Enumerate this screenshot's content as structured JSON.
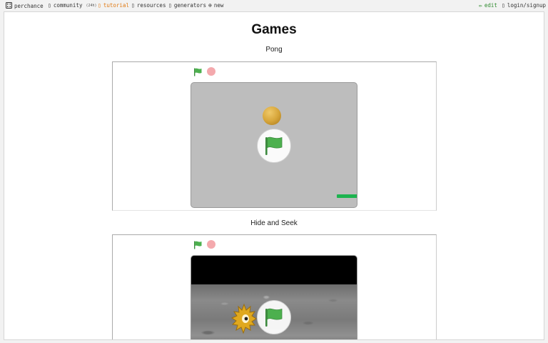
{
  "topbar": {
    "brand": "perchance",
    "community": "community",
    "community_badge": "(24h)",
    "tutorial": "tutorial",
    "resources": "resources",
    "generators": "generators",
    "new": "new",
    "edit": "edit",
    "login": "login/signup"
  },
  "page": {
    "title": "Games"
  },
  "games": [
    {
      "name": "Pong"
    },
    {
      "name": "Hide and Seek"
    }
  ],
  "colors": {
    "flag_green": "#4cb04e",
    "stop_pink": "#f4a9ad",
    "pong_stage": "#bdbdbd",
    "paddle_green": "#1db34f",
    "tutorial_orange": "#e07a14",
    "edit_green": "#2e8b2e"
  },
  "icons": {
    "brand": "dice-icon",
    "community": "chat-icon",
    "tutorial": "book-icon",
    "resources": "box-icon",
    "generators": "list-icon",
    "new": "plus-circle-icon",
    "edit": "pencil-icon",
    "login": "user-icon"
  }
}
